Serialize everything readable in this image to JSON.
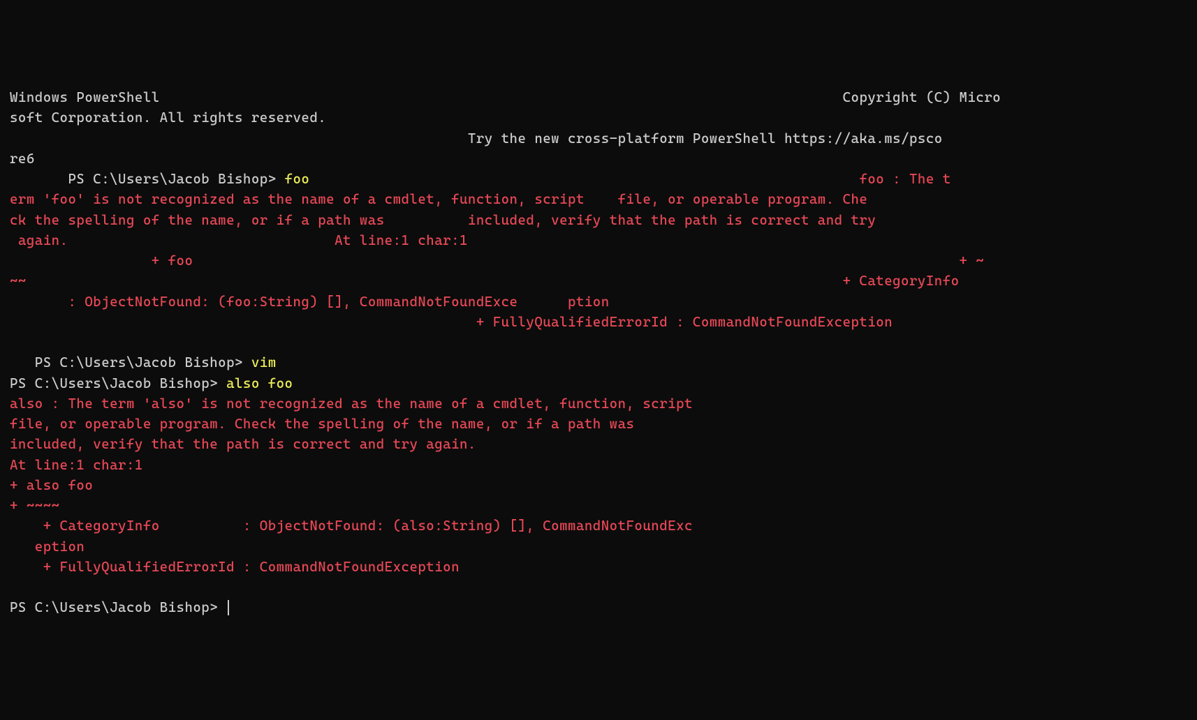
{
  "header": {
    "line1a": "Windows PowerShell",
    "line1b": "                                                                                  Copyright (C) Micro",
    "line2": "soft Corporation. All rights reserved.",
    "line3a": "                                                       Try the new cross-platform PowerShell https://aka.ms/psco",
    "line3b": "re6"
  },
  "block1": {
    "prompt_lead": "       PS C:\\Users\\Jacob Bishop> ",
    "cmd": "foo",
    "err_lead": "                                                                  foo : The t",
    "err1": "erm 'foo' is not recognized as the name of a cmdlet, function, script    file, or operable program. Che",
    "err2": "ck the spelling of the name, or if a path was          included, verify that the path is correct and try",
    "err3": " again.                                At line:1 char:1",
    "err4a": "                 + foo                                                                                            + ~",
    "err4b": "~~                                                                                                  + CategoryInfo  ",
    "err5": "       : ObjectNotFound: (foo:String) [], CommandNotFoundExce      ption",
    "err6": "                                                        + FullyQualifiedErrorId : CommandNotFoundException"
  },
  "block2": {
    "prompt_lead": "   PS C:\\Users\\Jacob Bishop> ",
    "cmd": "vim"
  },
  "block3": {
    "prompt": "PS C:\\Users\\Jacob Bishop> ",
    "cmd": "also foo",
    "err1": "also : The term 'also' is not recognized as the name of a cmdlet, function, script",
    "err2": "file, or operable program. Check the spelling of the name, or if a path was",
    "err3": "included, verify that the path is correct and try again.",
    "err4": "At line:1 char:1",
    "err5": "+ also foo",
    "err6": "+ ~~~~",
    "err7": "    + CategoryInfo          : ObjectNotFound: (also:String) [], CommandNotFoundExc",
    "err8": "   eption",
    "err9": "    + FullyQualifiedErrorId : CommandNotFoundException"
  },
  "final_prompt": "PS C:\\Users\\Jacob Bishop> "
}
